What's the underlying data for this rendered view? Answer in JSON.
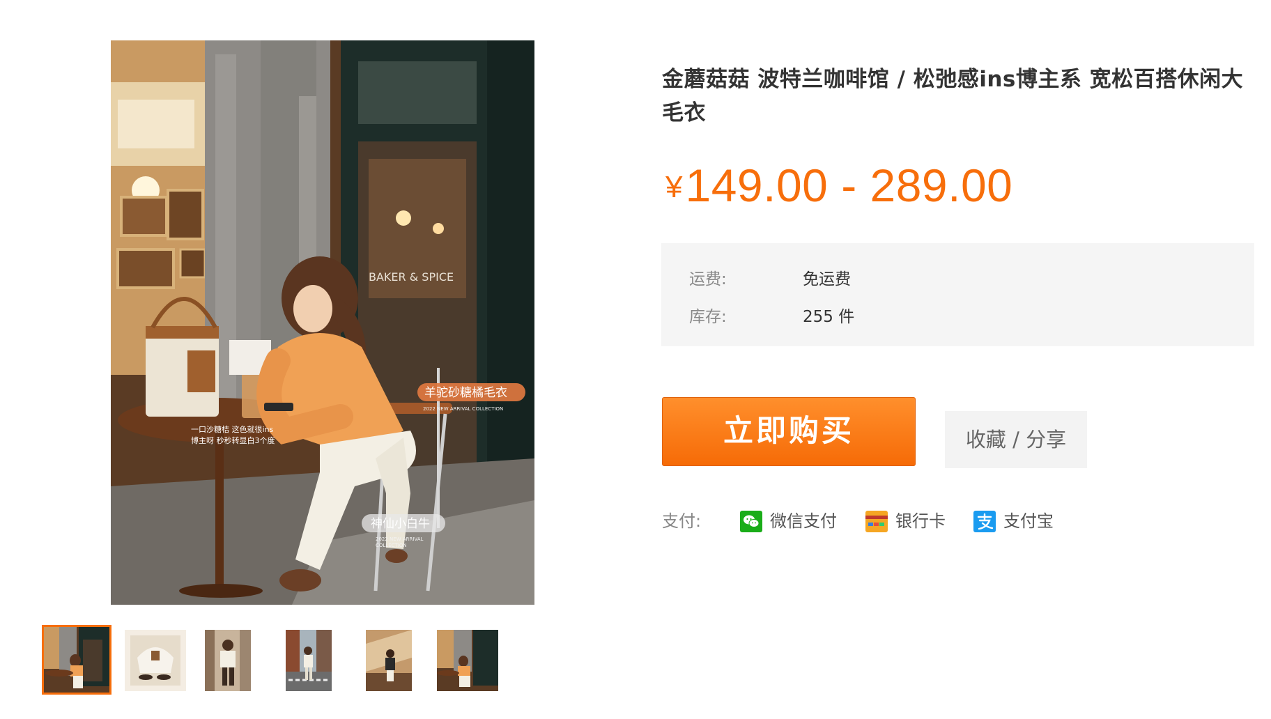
{
  "product": {
    "title": "金蘑菇菇 波特兰咖啡馆 / 松弛感ins博主系 宽松百搭休闲大毛衣",
    "price": {
      "currency": "¥",
      "range": "149.00 - 289.00"
    },
    "meta": {
      "shipping_label": "运费:",
      "shipping_value": "免运费",
      "stock_label": "库存:",
      "stock_value": "255 件"
    },
    "actions": {
      "buy_label": "立即购买",
      "fav_share_label": "收藏 / 分享"
    },
    "payment": {
      "label": "支付:",
      "methods": [
        {
          "name": "微信支付",
          "icon": "wechat-pay-icon"
        },
        {
          "name": "银行卡",
          "icon": "bank-card-icon"
        },
        {
          "name": "支付宝",
          "icon": "alipay-icon"
        }
      ]
    }
  },
  "gallery": {
    "overlay_texts": {
      "sweater_tag": "羊驼砂糖橘毛衣",
      "sweater_tag_sub": "2022 NEW ARRIVAL COLLECTION",
      "quote_line1": "一口沙糖桔 这色就很ins",
      "quote_line2": "博主呀 秒秒转显白3个度",
      "pants_tag": "神仙小白牛",
      "pants_tag_sub1": "2022 NEW ARRIVAL",
      "pants_tag_sub2": "COLLECTION",
      "window_sign": "BAKER & SPICE"
    },
    "thumbnail_count": 6,
    "active_thumbnail": 1
  },
  "colors": {
    "accent": "#f76e0b",
    "meta_bg": "#f5f5f5",
    "fav_bg": "#f3f3f3",
    "wechat": "#1aad19",
    "bank": "#f5a623",
    "alipay": "#1a9bf0"
  }
}
